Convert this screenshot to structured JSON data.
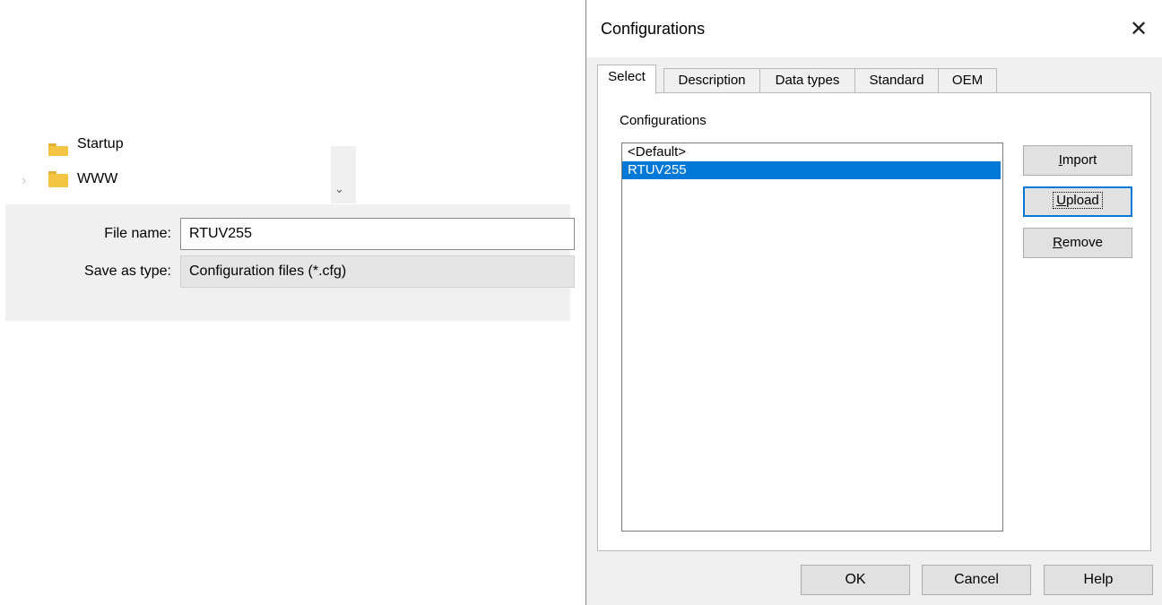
{
  "background_dialog": {
    "tree_items": [
      {
        "label": "Startup",
        "icon": "folder-icon"
      },
      {
        "label": "WWW",
        "icon": "folder-icon"
      }
    ],
    "file_name_label": "File name:",
    "file_name_value": "RTUV255",
    "save_type_label": "Save as type:",
    "save_type_value": "Configuration files (*.cfg)"
  },
  "dialog": {
    "title": "Configurations",
    "tabs": [
      {
        "label": "Select",
        "active": true
      },
      {
        "label": "Description",
        "active": false
      },
      {
        "label": "Data types",
        "active": false
      },
      {
        "label": "Standard",
        "active": false
      },
      {
        "label": "OEM",
        "active": false
      }
    ],
    "list_label": "Configurations",
    "list_items": [
      {
        "label": "<Default>",
        "selected": false
      },
      {
        "label": "RTUV255",
        "selected": true
      }
    ],
    "side_buttons": {
      "import": {
        "mnemonic": "I",
        "rest": "mport"
      },
      "upload": {
        "mnemonic": "U",
        "rest": "pload"
      },
      "remove": {
        "mnemonic": "R",
        "rest": "emove"
      }
    },
    "bottom_buttons": {
      "ok": "OK",
      "cancel": "Cancel",
      "help": "Help"
    }
  },
  "colors": {
    "selection": "#0078d7",
    "dialog_bg": "#f0f0f0",
    "folder": "#f4c542"
  }
}
